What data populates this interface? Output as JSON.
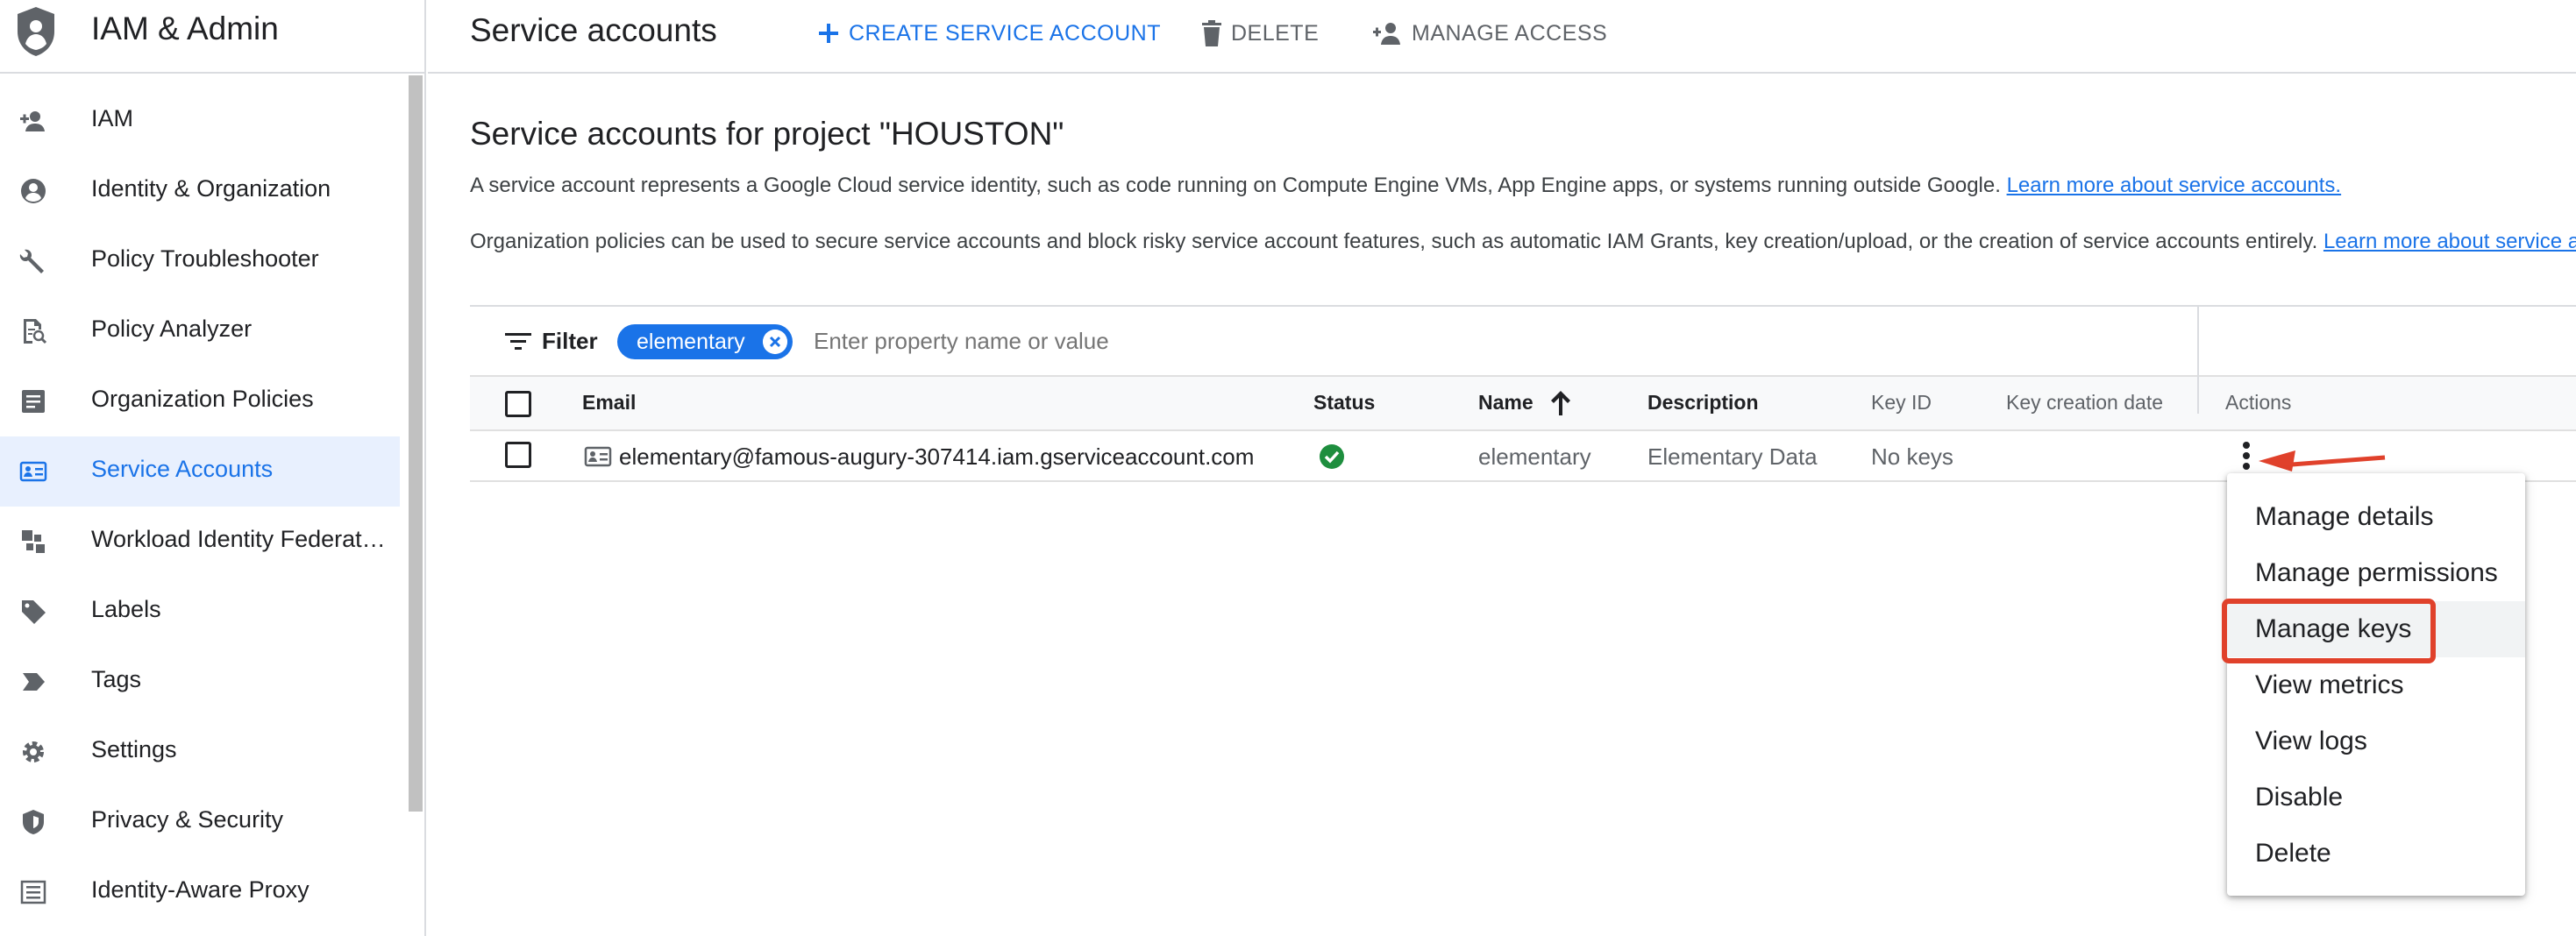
{
  "sidebar": {
    "title": "IAM & Admin",
    "items": [
      {
        "label": "IAM",
        "icon": "person-add-icon"
      },
      {
        "label": "Identity & Organization",
        "icon": "account-circle-icon"
      },
      {
        "label": "Policy Troubleshooter",
        "icon": "wrench-icon"
      },
      {
        "label": "Policy Analyzer",
        "icon": "document-search-icon"
      },
      {
        "label": "Organization Policies",
        "icon": "list-document-icon"
      },
      {
        "label": "Service Accounts",
        "icon": "service-account-icon",
        "active": true
      },
      {
        "label": "Workload Identity Federat…",
        "icon": "workload-identity-icon"
      },
      {
        "label": "Labels",
        "icon": "label-tag-icon"
      },
      {
        "label": "Tags",
        "icon": "tag-arrow-icon"
      },
      {
        "label": "Settings",
        "icon": "gear-icon"
      },
      {
        "label": "Privacy & Security",
        "icon": "shield-icon"
      },
      {
        "label": "Identity-Aware Proxy",
        "icon": "proxy-icon"
      }
    ]
  },
  "toolbar": {
    "title": "Service accounts",
    "create_label": "CREATE SERVICE ACCOUNT",
    "delete_label": "DELETE",
    "manage_access_label": "MANAGE ACCESS"
  },
  "main": {
    "heading": "Service accounts for project \"HOUSTON\"",
    "para1": "A service account represents a Google Cloud service identity, such as code running on Compute Engine VMs, App Engine apps, or systems running outside Google. ",
    "para1_link": "Learn more about service accounts.",
    "para2": "Organization policies can be used to secure service accounts and block risky service account features, such as automatic IAM Grants, key creation/upload, or the creation of service accounts entirely. ",
    "para2_link": "Learn more about service a"
  },
  "filter": {
    "label": "Filter",
    "chip": "elementary",
    "placeholder": "Enter property name or value"
  },
  "table": {
    "columns": {
      "email": "Email",
      "status": "Status",
      "name": "Name",
      "description": "Description",
      "key_id": "Key ID",
      "key_creation_date": "Key creation date",
      "actions": "Actions"
    },
    "rows": [
      {
        "email": "elementary@famous-augury-307414.iam.gserviceaccount.com",
        "status": "enabled",
        "name": "elementary",
        "description": "Elementary Data",
        "key_id": "No keys",
        "key_creation_date": ""
      }
    ]
  },
  "actions_menu": {
    "items": [
      "Manage details",
      "Manage permissions",
      "Manage keys",
      "View metrics",
      "View logs",
      "Disable",
      "Delete"
    ],
    "highlighted": "Manage keys"
  },
  "colors": {
    "accent": "#1a73e8",
    "annotation": "#e0412b",
    "status_ok": "#1e8e3e"
  }
}
